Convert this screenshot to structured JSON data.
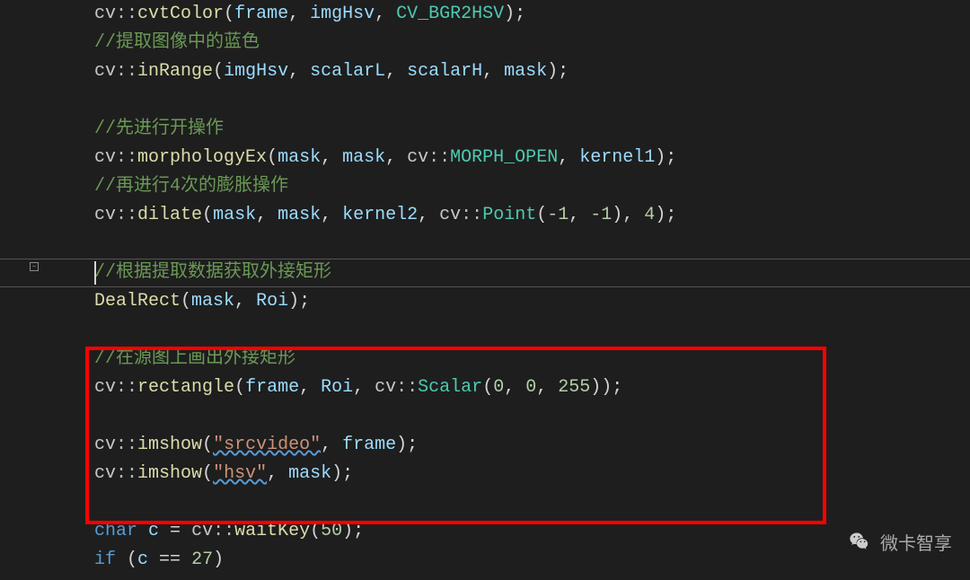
{
  "lines": {
    "l0": {
      "ns": "cv",
      "scope": "::",
      "fn": "cvtColor",
      "p1": "frame",
      "p2": "imgHsv",
      "p3": "CV_BGR2HSV"
    },
    "l1": {
      "comment": "//提取图像中的蓝色"
    },
    "l2": {
      "ns": "cv",
      "scope": "::",
      "fn": "inRange",
      "p1": "imgHsv",
      "p2": "scalarL",
      "p3": "scalarH",
      "p4": "mask"
    },
    "l3": {
      "comment": "//先进行开操作"
    },
    "l4": {
      "ns": "cv",
      "scope": "::",
      "fn": "morphologyEx",
      "p1": "mask",
      "p2": "mask",
      "ns2": "cv",
      "p3": "MORPH_OPEN",
      "p4": "kernel1"
    },
    "l5": {
      "comment": "//再进行4次的膨胀操作"
    },
    "l6": {
      "ns": "cv",
      "scope": "::",
      "fn": "dilate",
      "p1": "mask",
      "p2": "mask",
      "p3": "kernel2",
      "ns2": "cv",
      "type": "Point",
      "n1": "-1",
      "n2": "-1",
      "n3": "4"
    },
    "l7": {
      "comment": "//根据提取数据获取外接矩形"
    },
    "l8": {
      "fn": "DealRect",
      "p1": "mask",
      "p2": "Roi"
    },
    "l9": {
      "comment": "//在源图上画出外接矩形"
    },
    "l10": {
      "ns": "cv",
      "scope": "::",
      "fn": "rectangle",
      "p1": "frame",
      "p2": "Roi",
      "ns2": "cv",
      "type": "Scalar",
      "n1": "0",
      "n2": "0",
      "n3": "255"
    },
    "l11": {
      "ns": "cv",
      "scope": "::",
      "fn": "imshow",
      "str": "\"srcvideo\"",
      "p1": "frame"
    },
    "l12": {
      "ns": "cv",
      "scope": "::",
      "fn": "imshow",
      "str": "\"hsv\"",
      "p1": "mask"
    },
    "l13": {
      "kw": "char",
      "var": "c",
      "ns": "cv",
      "scope": "::",
      "fn": "waitKey",
      "n1": "50"
    },
    "l14": {
      "kw": "if ",
      "paren": "(",
      "var": "c",
      "op": " == ",
      "num": "27",
      "paren2": ")"
    }
  },
  "watermark": "微卡智享"
}
